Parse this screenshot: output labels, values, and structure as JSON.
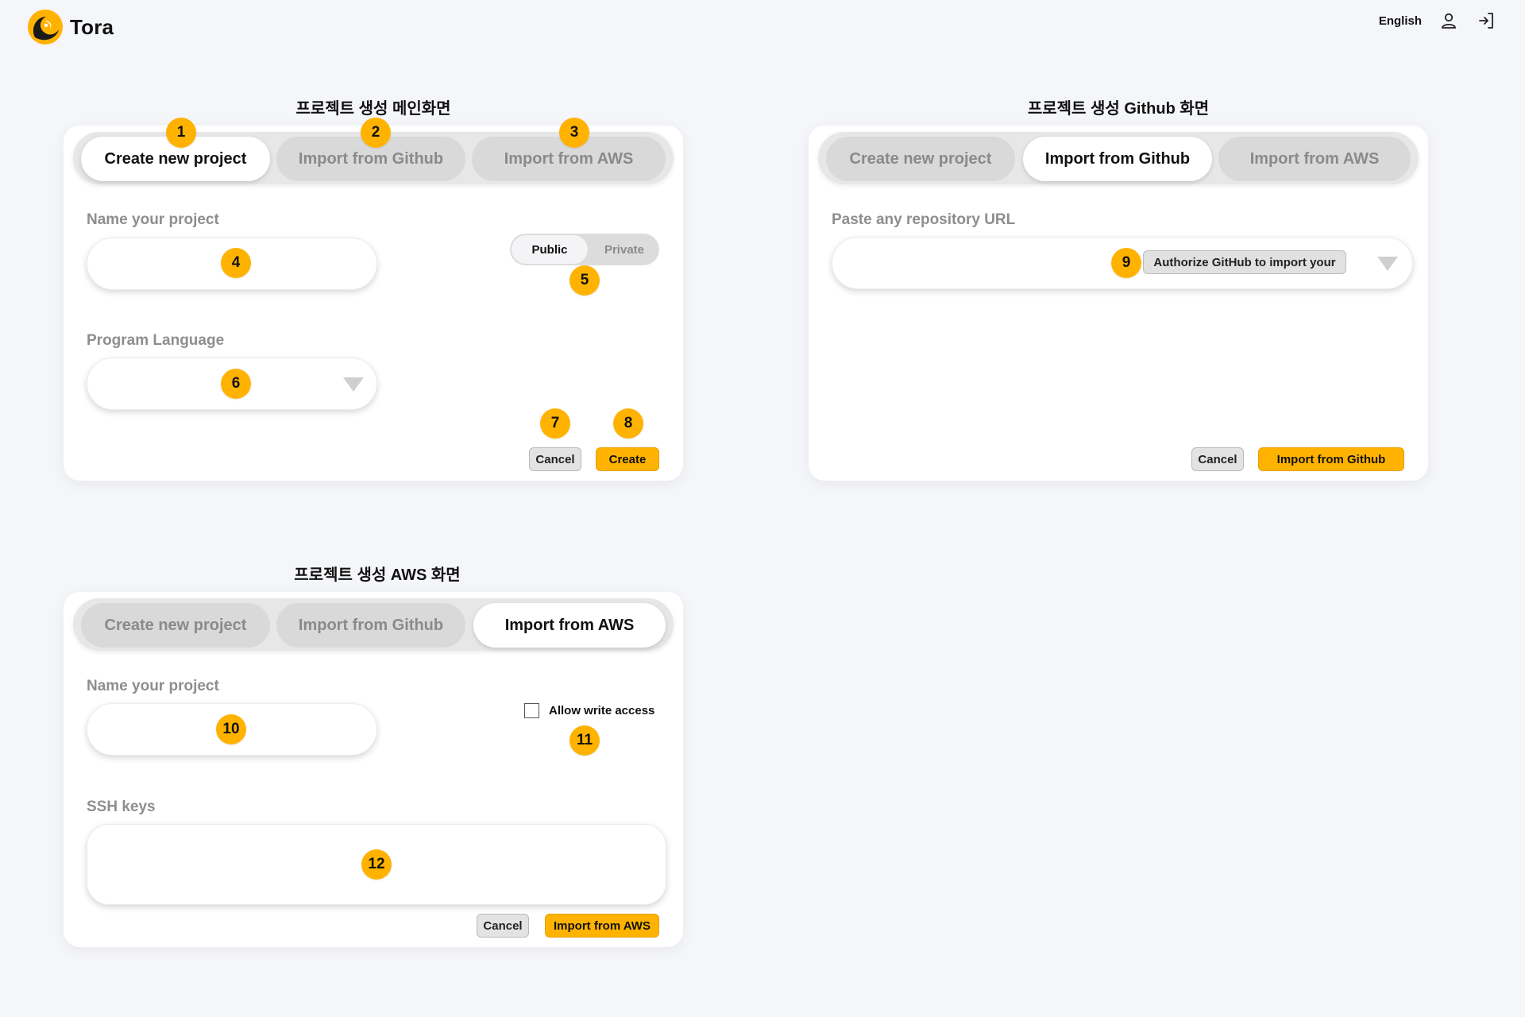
{
  "header": {
    "app_name": "Tora",
    "language": "English",
    "icons": [
      "user-icon",
      "login-icon"
    ]
  },
  "colors": {
    "accent": "#ffb300",
    "background": "#f5f6fa",
    "card": "#ffffff",
    "tab_inactive": "#d9d9d9",
    "text_muted": "#8e8e8e"
  },
  "tabs": {
    "create": "Create new project",
    "github": "Import from Github",
    "aws": "Import from AWS"
  },
  "main": {
    "title": "프로젝트 생성 메인화면",
    "name_label": "Name your project",
    "name_value": "",
    "visibility": {
      "public": "Public",
      "private": "Private",
      "selected": "Public"
    },
    "language_label": "Program Language",
    "language_value": "",
    "cancel": "Cancel",
    "create": "Create"
  },
  "github": {
    "title": "프로젝트 생성 Github 화면",
    "url_label": "Paste any repository URL",
    "url_value": "",
    "authorize": "Authorize GitHub to import your",
    "cancel": "Cancel",
    "import": "Import from Github"
  },
  "aws": {
    "title": "프로젝트 생성 AWS 화면",
    "name_label": "Name your project",
    "name_value": "",
    "allow_write": "Allow write access",
    "allow_write_checked": false,
    "ssh_label": "SSH keys",
    "ssh_value": "",
    "cancel": "Cancel",
    "import": "Import from AWS"
  },
  "markers": [
    "1",
    "2",
    "3",
    "4",
    "5",
    "6",
    "7",
    "8",
    "9",
    "10",
    "11",
    "12"
  ]
}
